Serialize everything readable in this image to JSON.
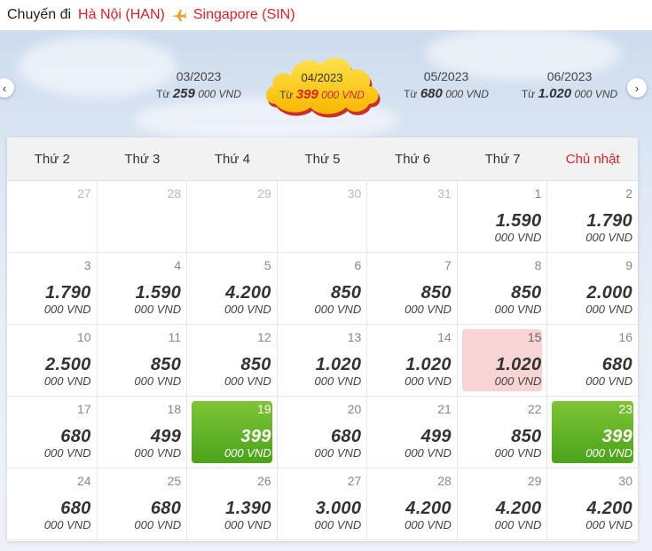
{
  "header": {
    "label": "Chuyến đi",
    "origin": "Hà Nội (HAN)",
    "destination": "Singapore (SIN)"
  },
  "months": [
    {
      "name": "03/2023",
      "prefix": "Từ",
      "price": "259",
      "unit": "000 VND",
      "active": false
    },
    {
      "name": "04/2023",
      "prefix": "Từ",
      "price": "399",
      "unit": "000 VND",
      "active": true
    },
    {
      "name": "05/2023",
      "prefix": "Từ",
      "price": "680",
      "unit": "000 VND",
      "active": false
    },
    {
      "name": "06/2023",
      "prefix": "Từ",
      "price": "1.020",
      "unit": "000 VND",
      "active": false
    }
  ],
  "nav": {
    "prev": "‹",
    "next": "›"
  },
  "weekdays": [
    "Thứ 2",
    "Thứ 3",
    "Thứ 4",
    "Thứ 5",
    "Thứ 6",
    "Thứ 7",
    "Chủ nhật"
  ],
  "unit": "000 VND",
  "days": [
    {
      "day": "27",
      "price": "",
      "state": "muted"
    },
    {
      "day": "28",
      "price": "",
      "state": "muted"
    },
    {
      "day": "29",
      "price": "",
      "state": "muted"
    },
    {
      "day": "30",
      "price": "",
      "state": "muted"
    },
    {
      "day": "31",
      "price": "",
      "state": "muted"
    },
    {
      "day": "1",
      "price": "1.590",
      "state": ""
    },
    {
      "day": "2",
      "price": "1.790",
      "state": ""
    },
    {
      "day": "3",
      "price": "1.790",
      "state": ""
    },
    {
      "day": "4",
      "price": "1.590",
      "state": ""
    },
    {
      "day": "5",
      "price": "4.200",
      "state": ""
    },
    {
      "day": "6",
      "price": "850",
      "state": ""
    },
    {
      "day": "7",
      "price": "850",
      "state": ""
    },
    {
      "day": "8",
      "price": "850",
      "state": ""
    },
    {
      "day": "9",
      "price": "2.000",
      "state": ""
    },
    {
      "day": "10",
      "price": "2.500",
      "state": ""
    },
    {
      "day": "11",
      "price": "850",
      "state": ""
    },
    {
      "day": "12",
      "price": "850",
      "state": ""
    },
    {
      "day": "13",
      "price": "1.020",
      "state": ""
    },
    {
      "day": "14",
      "price": "1.020",
      "state": ""
    },
    {
      "day": "15",
      "price": "1.020",
      "state": "sel"
    },
    {
      "day": "16",
      "price": "680",
      "state": ""
    },
    {
      "day": "17",
      "price": "680",
      "state": ""
    },
    {
      "day": "18",
      "price": "499",
      "state": ""
    },
    {
      "day": "19",
      "price": "399",
      "state": "cheap"
    },
    {
      "day": "20",
      "price": "680",
      "state": ""
    },
    {
      "day": "21",
      "price": "499",
      "state": ""
    },
    {
      "day": "22",
      "price": "850",
      "state": ""
    },
    {
      "day": "23",
      "price": "399",
      "state": "cheap"
    },
    {
      "day": "24",
      "price": "680",
      "state": ""
    },
    {
      "day": "25",
      "price": "680",
      "state": ""
    },
    {
      "day": "26",
      "price": "1.390",
      "state": ""
    },
    {
      "day": "27",
      "price": "3.000",
      "state": ""
    },
    {
      "day": "28",
      "price": "4.200",
      "state": ""
    },
    {
      "day": "29",
      "price": "4.200",
      "state": ""
    },
    {
      "day": "30",
      "price": "4.200",
      "state": ""
    }
  ],
  "colors": {
    "accent": "#d8232a",
    "cheap": "#5bb025",
    "selected": "#f8d4d4",
    "cloud": "#ffd21a"
  }
}
